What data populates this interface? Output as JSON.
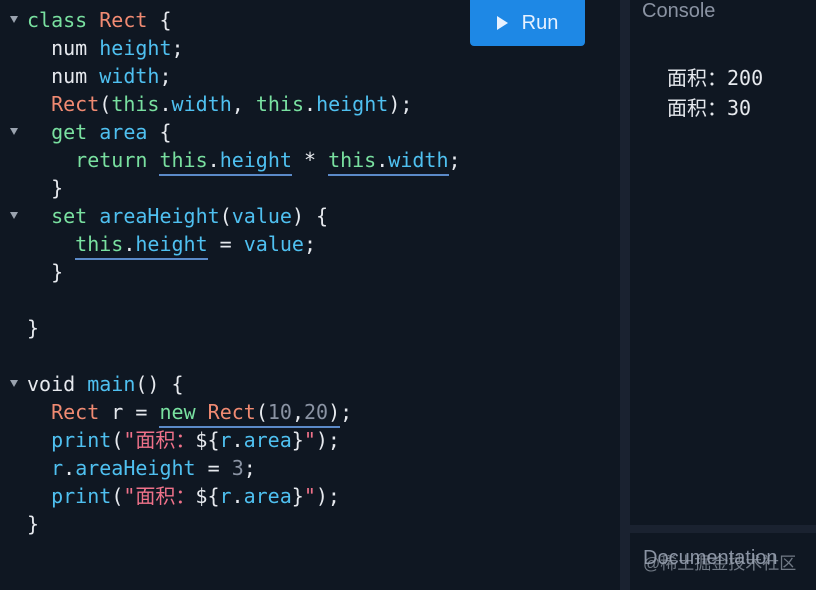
{
  "toolbar": {
    "run_label": "Run"
  },
  "console": {
    "title": "Console",
    "output": [
      "面积：200",
      "面积：30"
    ]
  },
  "docs": {
    "title": "Documentation"
  },
  "watermark": "@稀土掘金技术社区",
  "code": [
    {
      "fold": true,
      "tokens": [
        {
          "t": "class ",
          "c": "kw"
        },
        {
          "t": "Rect",
          "c": "ty"
        },
        {
          "t": " {",
          "c": "wh"
        }
      ]
    },
    {
      "fold": false,
      "tokens": [
        {
          "t": "  num ",
          "c": "wh"
        },
        {
          "t": "height",
          "c": "id"
        },
        {
          "t": ";",
          "c": "wh"
        }
      ]
    },
    {
      "fold": false,
      "tokens": [
        {
          "t": "  num ",
          "c": "wh"
        },
        {
          "t": "width",
          "c": "id"
        },
        {
          "t": ";",
          "c": "wh"
        }
      ]
    },
    {
      "fold": false,
      "tokens": [
        {
          "t": "  ",
          "c": "wh"
        },
        {
          "t": "Rect",
          "c": "ty"
        },
        {
          "t": "(",
          "c": "wh"
        },
        {
          "t": "this",
          "c": "kw"
        },
        {
          "t": ".",
          "c": "wh"
        },
        {
          "t": "width",
          "c": "id"
        },
        {
          "t": ", ",
          "c": "wh"
        },
        {
          "t": "this",
          "c": "kw"
        },
        {
          "t": ".",
          "c": "wh"
        },
        {
          "t": "height",
          "c": "id"
        },
        {
          "t": ");",
          "c": "wh"
        }
      ]
    },
    {
      "fold": true,
      "tokens": [
        {
          "t": "  ",
          "c": "wh"
        },
        {
          "t": "get ",
          "c": "kw"
        },
        {
          "t": "area",
          "c": "id"
        },
        {
          "t": " {",
          "c": "wh"
        }
      ]
    },
    {
      "fold": false,
      "tokens": [
        {
          "t": "    ",
          "c": "wh"
        },
        {
          "t": "return ",
          "c": "kw"
        },
        {
          "t": "this",
          "c": "kw",
          "u": true
        },
        {
          "t": ".",
          "c": "wh",
          "u": true
        },
        {
          "t": "height",
          "c": "id",
          "u": true
        },
        {
          "t": " * ",
          "c": "wh"
        },
        {
          "t": "this",
          "c": "kw",
          "u": true
        },
        {
          "t": ".",
          "c": "wh",
          "u": true
        },
        {
          "t": "width",
          "c": "id",
          "u": true
        },
        {
          "t": ";",
          "c": "wh"
        }
      ]
    },
    {
      "fold": false,
      "tokens": [
        {
          "t": "  }",
          "c": "wh"
        }
      ]
    },
    {
      "fold": true,
      "tokens": [
        {
          "t": "  ",
          "c": "wh"
        },
        {
          "t": "set ",
          "c": "kw"
        },
        {
          "t": "areaHeight",
          "c": "id"
        },
        {
          "t": "(",
          "c": "wh"
        },
        {
          "t": "value",
          "c": "id"
        },
        {
          "t": ") {",
          "c": "wh"
        }
      ]
    },
    {
      "fold": false,
      "tokens": [
        {
          "t": "    ",
          "c": "wh"
        },
        {
          "t": "this",
          "c": "kw",
          "u": true
        },
        {
          "t": ".",
          "c": "wh",
          "u": true
        },
        {
          "t": "height",
          "c": "id",
          "u": true
        },
        {
          "t": " = ",
          "c": "wh"
        },
        {
          "t": "value",
          "c": "id"
        },
        {
          "t": ";",
          "c": "wh"
        }
      ]
    },
    {
      "fold": false,
      "tokens": [
        {
          "t": "  }",
          "c": "wh"
        }
      ]
    },
    {
      "fold": false,
      "tokens": []
    },
    {
      "fold": false,
      "tokens": [
        {
          "t": "}",
          "c": "wh"
        }
      ]
    },
    {
      "fold": false,
      "tokens": []
    },
    {
      "fold": true,
      "tokens": [
        {
          "t": "void ",
          "c": "wh"
        },
        {
          "t": "main",
          "c": "id"
        },
        {
          "t": "() {",
          "c": "wh"
        }
      ]
    },
    {
      "fold": false,
      "tokens": [
        {
          "t": "  ",
          "c": "wh"
        },
        {
          "t": "Rect",
          "c": "ty"
        },
        {
          "t": " r = ",
          "c": "wh"
        },
        {
          "t": "new ",
          "c": "kw",
          "u": true
        },
        {
          "t": "Rect",
          "c": "ty",
          "u": true
        },
        {
          "t": "(",
          "c": "wh",
          "u": true
        },
        {
          "t": "10",
          "c": "num",
          "u": true
        },
        {
          "t": ",",
          "c": "wh",
          "u": true
        },
        {
          "t": "20",
          "c": "num",
          "u": true
        },
        {
          "t": ")",
          "c": "wh",
          "u": true
        },
        {
          "t": ";",
          "c": "wh"
        }
      ]
    },
    {
      "fold": false,
      "tokens": [
        {
          "t": "  ",
          "c": "wh"
        },
        {
          "t": "print",
          "c": "id"
        },
        {
          "t": "(",
          "c": "wh"
        },
        {
          "t": "\"面积：",
          "c": "str"
        },
        {
          "t": "${",
          "c": "wh"
        },
        {
          "t": "r",
          "c": "id"
        },
        {
          "t": ".",
          "c": "wh"
        },
        {
          "t": "area",
          "c": "id"
        },
        {
          "t": "}",
          "c": "wh"
        },
        {
          "t": "\"",
          "c": "str"
        },
        {
          "t": ");",
          "c": "wh"
        }
      ]
    },
    {
      "fold": false,
      "tokens": [
        {
          "t": "  ",
          "c": "wh"
        },
        {
          "t": "r",
          "c": "id"
        },
        {
          "t": ".",
          "c": "wh"
        },
        {
          "t": "areaHeight",
          "c": "id"
        },
        {
          "t": " = ",
          "c": "wh"
        },
        {
          "t": "3",
          "c": "num"
        },
        {
          "t": ";",
          "c": "wh"
        }
      ]
    },
    {
      "fold": false,
      "tokens": [
        {
          "t": "  ",
          "c": "wh"
        },
        {
          "t": "print",
          "c": "id"
        },
        {
          "t": "(",
          "c": "wh"
        },
        {
          "t": "\"面积：",
          "c": "str"
        },
        {
          "t": "${",
          "c": "wh"
        },
        {
          "t": "r",
          "c": "id"
        },
        {
          "t": ".",
          "c": "wh"
        },
        {
          "t": "area",
          "c": "id"
        },
        {
          "t": "}",
          "c": "wh"
        },
        {
          "t": "\"",
          "c": "str"
        },
        {
          "t": ");",
          "c": "wh"
        }
      ]
    },
    {
      "fold": false,
      "tokens": [
        {
          "t": "}",
          "c": "wh"
        }
      ]
    }
  ]
}
